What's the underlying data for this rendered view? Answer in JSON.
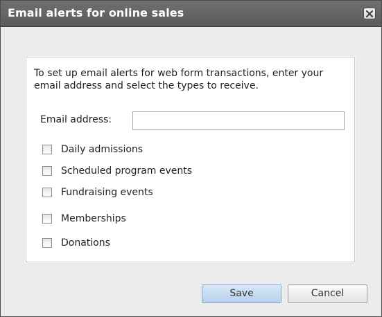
{
  "dialog": {
    "title": "Email alerts for online sales",
    "close_icon": "close-icon"
  },
  "content": {
    "instructions": "To set up email alerts for web form transactions, enter your email address and select the types to receive.",
    "email_label": "Email address:",
    "email_value": "",
    "email_placeholder": ""
  },
  "alert_types": [
    {
      "label": "Daily admissions",
      "checked": false
    },
    {
      "label": "Scheduled program events",
      "checked": false
    },
    {
      "label": "Fundraising events",
      "checked": false
    },
    {
      "label": "Memberships",
      "checked": false
    },
    {
      "label": "Donations",
      "checked": false
    }
  ],
  "actions": {
    "save_label": "Save",
    "cancel_label": "Cancel"
  },
  "colors": {
    "title_bar": "#5f5f5f",
    "dialog_background": "#ececec",
    "save_button": "#c7ddf2"
  }
}
